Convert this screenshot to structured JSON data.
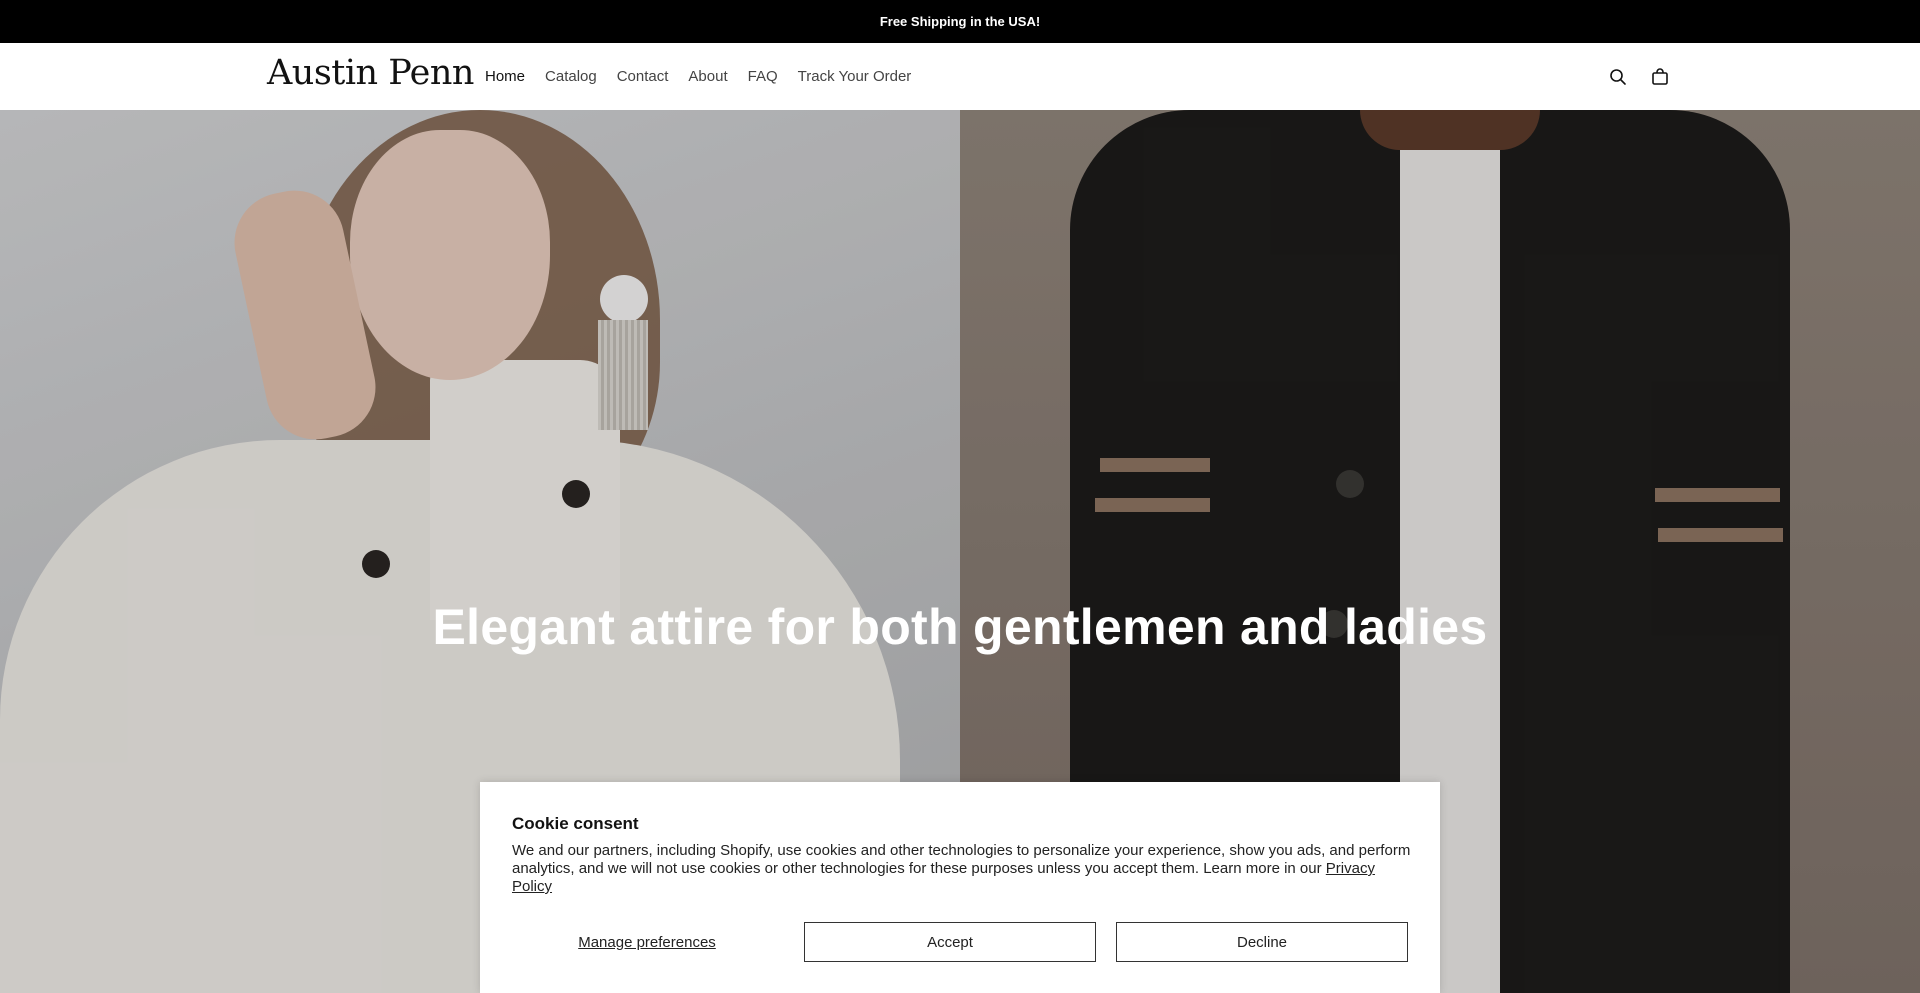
{
  "announcement": {
    "text": "Free Shipping in the USA!"
  },
  "header": {
    "logo": "Austin Penn",
    "nav": [
      {
        "label": "Home",
        "active": true
      },
      {
        "label": "Catalog"
      },
      {
        "label": "Contact"
      },
      {
        "label": "About"
      },
      {
        "label": "FAQ"
      },
      {
        "label": "Track Your Order"
      }
    ],
    "icons": [
      "search-icon",
      "cart-icon"
    ]
  },
  "hero": {
    "title": "Elegant attire for both gentlemen and ladies"
  },
  "cookie": {
    "title": "Cookie consent",
    "text": "We and our partners, including Shopify, use cookies and other technologies to personalize your experience, show you ads, and perform analytics, and we will not use cookies or other technologies for these purposes unless you accept them. Learn more in our",
    "link": "Privacy Policy",
    "manage_label": "Manage preferences",
    "accept_label": "Accept",
    "decline_label": "Decline"
  }
}
